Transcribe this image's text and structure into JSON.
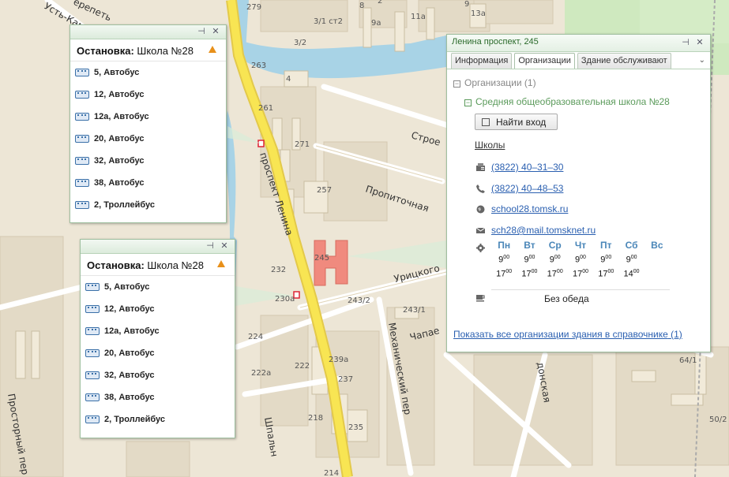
{
  "map": {
    "street_labels": [
      "проспект Ленина",
      "Пропиточная",
      "Строе",
      "Урицкого",
      "Чапае",
      "Механический пер",
      "Шпальн",
      "Просторный пер",
      "донская",
      "Усть-Кам",
      "ерепеть"
    ],
    "building_numbers": [
      "279",
      "263",
      "261",
      "271",
      "257",
      "245",
      "232",
      "230а",
      "243/2",
      "243/1",
      "224",
      "222а",
      "222",
      "239а",
      "237",
      "235",
      "218",
      "214",
      "4",
      "3/1 ст2",
      "3/2",
      "9а",
      "11а",
      "13а",
      "64/1",
      "50/2",
      "2",
      "9",
      "8"
    ]
  },
  "stop_popup_1": {
    "prefix": "Остановка:",
    "name": "Школа №28",
    "routes": [
      {
        "label": "5, Автобус",
        "icon": "bus-icon"
      },
      {
        "label": "12, Автобус",
        "icon": "bus-icon"
      },
      {
        "label": "12а, Автобус",
        "icon": "bus-icon"
      },
      {
        "label": "20, Автобус",
        "icon": "bus-icon"
      },
      {
        "label": "32, Автобус",
        "icon": "bus-icon"
      },
      {
        "label": "38, Автобус",
        "icon": "bus-icon"
      },
      {
        "label": "2, Троллейбус",
        "icon": "trolleybus-icon"
      }
    ]
  },
  "stop_popup_2": {
    "prefix": "Остановка:",
    "name": "Школа №28",
    "routes": [
      {
        "label": "5, Автобус",
        "icon": "bus-icon"
      },
      {
        "label": "12, Автобус",
        "icon": "bus-icon"
      },
      {
        "label": "12а, Автобус",
        "icon": "bus-icon"
      },
      {
        "label": "20, Автобус",
        "icon": "bus-icon"
      },
      {
        "label": "32, Автобус",
        "icon": "bus-icon"
      },
      {
        "label": "38, Автобус",
        "icon": "bus-icon"
      },
      {
        "label": "2, Троллейбус",
        "icon": "trolleybus-icon"
      }
    ]
  },
  "building_popup": {
    "title": "Ленина проспект, 245",
    "tabs": [
      "Информация",
      "Организации",
      "Здание обслуживают"
    ],
    "active_tab": "Организации",
    "tree_root": "Организации (1)",
    "org_name": "Средняя общеобразовательная школа №28",
    "find_entrance": "Найти вход",
    "category": "Школы",
    "fax": "(3822) 40–31–30",
    "phone": "(3822) 40–48–53",
    "website": "school28.tomsk.ru",
    "email": "sch28@mail.tomsknet.ru",
    "days": [
      "Пн",
      "Вт",
      "Ср",
      "Чт",
      "Пт",
      "Сб",
      "Вс"
    ],
    "open_hours": [
      "9",
      "9",
      "9",
      "9",
      "9",
      "9",
      ""
    ],
    "close_hours": [
      "17",
      "17",
      "17",
      "17",
      "17",
      "14",
      ""
    ],
    "minutes": "00",
    "lunch": "Без обеда",
    "show_all_link": "Показать все организации здания в справочнике",
    "show_all_count": "(1)"
  },
  "colors": {
    "map_bg": "#ede6d6",
    "river": "#a8d3e6",
    "main_road": "#f5e24a",
    "highlight_building": "#f08a7e",
    "accent_green": "#2a6a2a",
    "link_blue": "#2a5fb0"
  }
}
